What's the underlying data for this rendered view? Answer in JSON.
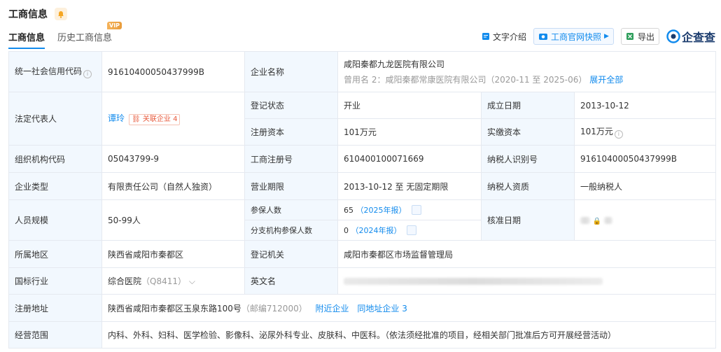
{
  "header": {
    "title": "工商信息"
  },
  "tabs": [
    {
      "label": "工商信息"
    },
    {
      "label": "历史工商信息"
    }
  ],
  "vip_badge": "VIP",
  "actions": {
    "text_intro": "文字介绍",
    "snapshot": "工商官网快照",
    "export": "导出",
    "brand": "企查查"
  },
  "colors": {
    "accent": "#128bed",
    "label_bg": "#f2f8fe",
    "related": "#e85a3c"
  },
  "rows": {
    "credit_code": {
      "label": "统一社会信用代码",
      "value": "91610400050437999B"
    },
    "company_name": {
      "label": "企业名称",
      "value": "咸阳秦都九龙医院有限公司",
      "former_prefix": "曾用名 2：",
      "former_value": "咸阳秦都常康医院有限公司（2020-11 至 2025-06）",
      "expand": "展开全部"
    },
    "legal_rep": {
      "label": "法定代表人",
      "value": "谭玲",
      "related": "关联企业",
      "related_count": "4"
    },
    "reg_status": {
      "label": "登记状态",
      "value": "开业"
    },
    "found_date": {
      "label": "成立日期",
      "value": "2013-10-12"
    },
    "reg_capital": {
      "label": "注册资本",
      "value": "101万元"
    },
    "paid_capital": {
      "label": "实缴资本",
      "value": "101万元"
    },
    "org_code": {
      "label": "组织机构代码",
      "value": "05043799-9"
    },
    "reg_no": {
      "label": "工商注册号",
      "value": "610400100071669"
    },
    "taxpayer_id": {
      "label": "纳税人识别号",
      "value": "91610400050437999B"
    },
    "company_type": {
      "label": "企业类型",
      "value": "有限责任公司（自然人独资）"
    },
    "business_term": {
      "label": "营业期限",
      "value": "2013-10-12 至 无固定期限"
    },
    "taxpayer_qual": {
      "label": "纳税人资质",
      "value": "一般纳税人"
    },
    "staff_size": {
      "label": "人员规模",
      "value": "50-99人"
    },
    "insured": {
      "label": "参保人数",
      "value": "65",
      "year": "（2025年报）"
    },
    "branch_insured": {
      "label": "分支机构参保人数",
      "value": "0",
      "year": "（2024年报）"
    },
    "approval_date": {
      "label": "核准日期"
    },
    "region": {
      "label": "所属地区",
      "value": "陕西省咸阳市秦都区"
    },
    "reg_authority": {
      "label": "登记机关",
      "value": "咸阳市秦都区市场监督管理局"
    },
    "industry": {
      "label": "国标行业",
      "value": "综合医院",
      "code": "（Q8411）"
    },
    "english_name": {
      "label": "英文名"
    },
    "address": {
      "label": "注册地址",
      "value": "陕西省咸阳市秦都区玉泉东路100号",
      "postcode": "（邮编712000）",
      "nearby": "附近企业",
      "same_address": "同地址企业",
      "same_address_count": "3"
    },
    "scope": {
      "label": "经营范围",
      "value": "内科、外科、妇科、医学检验、影像科、泌尿外科专业、皮肤科、中医科。（依法须经批准的项目，经相关部门批准后方可开展经营活动）"
    }
  }
}
